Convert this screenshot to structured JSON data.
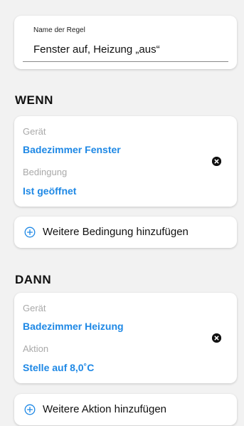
{
  "rule": {
    "name_label": "Name der Regel",
    "name_value": "Fenster auf, Heizung „aus“"
  },
  "wenn": {
    "title": "WENN",
    "device_label": "Gerät",
    "device_value": "Badezimmer Fenster",
    "condition_label": "Bedingung",
    "condition_value": "Ist geöffnet",
    "add_label": "Weitere Bedingung hinzufügen"
  },
  "dann": {
    "title": "DANN",
    "device_label": "Gerät",
    "device_value": "Badezimmer Heizung",
    "action_label": "Aktion",
    "action_value": "Stelle auf 8,0˚C",
    "add_label": "Weitere Aktion hinzufügen"
  },
  "colors": {
    "accent": "#1e88e5",
    "label_gray": "#a9a9a9",
    "background": "#f2f2f2",
    "remove_icon": "#111111"
  },
  "icons": {
    "remove": "close-circle-icon",
    "add": "plus-circle-icon"
  }
}
